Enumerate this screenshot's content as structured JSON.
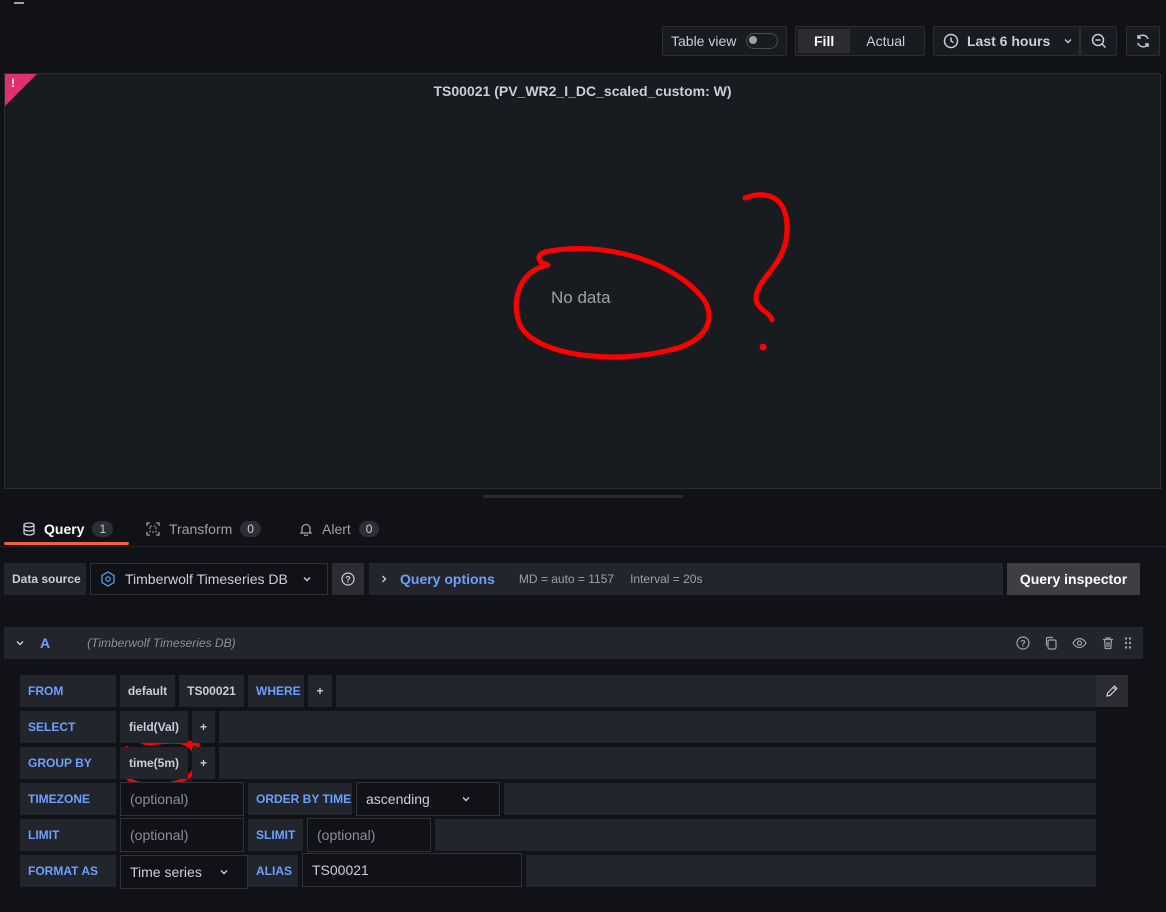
{
  "toolbar": {
    "table_view_label": "Table view",
    "fill_label": "Fill",
    "actual_label": "Actual",
    "time_range_label": "Last 6 hours"
  },
  "panel": {
    "title": "TS00021 (PV_WR2_I_DC_scaled_custom: W)",
    "no_data": "No data",
    "annotation_question": "?"
  },
  "tabs": [
    {
      "label": "Query",
      "count": "1"
    },
    {
      "label": "Transform",
      "count": "0"
    },
    {
      "label": "Alert",
      "count": "0"
    }
  ],
  "query_bar": {
    "data_source_label": "Data source",
    "data_source_value": "Timberwolf Timeseries DB",
    "query_options_label": "Query options",
    "md_info": "MD = auto = 1157",
    "interval_info": "Interval = 20s",
    "inspector_label": "Query inspector"
  },
  "query": {
    "ref_id": "A",
    "datasource_note": "(Timberwolf Timeseries DB)",
    "from_label": "FROM",
    "from_policy": "default",
    "from_measurement": "TS00021",
    "where_label": "WHERE",
    "plus": "+",
    "select_label": "SELECT",
    "select_value": "field(Val)",
    "groupby_label": "GROUP BY",
    "groupby_value": "time(5m)",
    "timezone_label": "TIMEZONE",
    "optional_placeholder": "(optional)",
    "orderby_label": "ORDER BY TIME",
    "orderby_value": "ascending",
    "limit_label": "LIMIT",
    "slimit_label": "SLIMIT",
    "format_label": "FORMAT AS",
    "format_value": "Time series",
    "alias_label": "ALIAS",
    "alias_value": "TS00021"
  },
  "colors": {
    "background": "#111217",
    "panel": "#181b1f",
    "accent_blue": "#6e9fff",
    "tab_underline": "#f55f3e",
    "annotation_red": "#ff0000",
    "error_corner": "#e02f6e"
  }
}
